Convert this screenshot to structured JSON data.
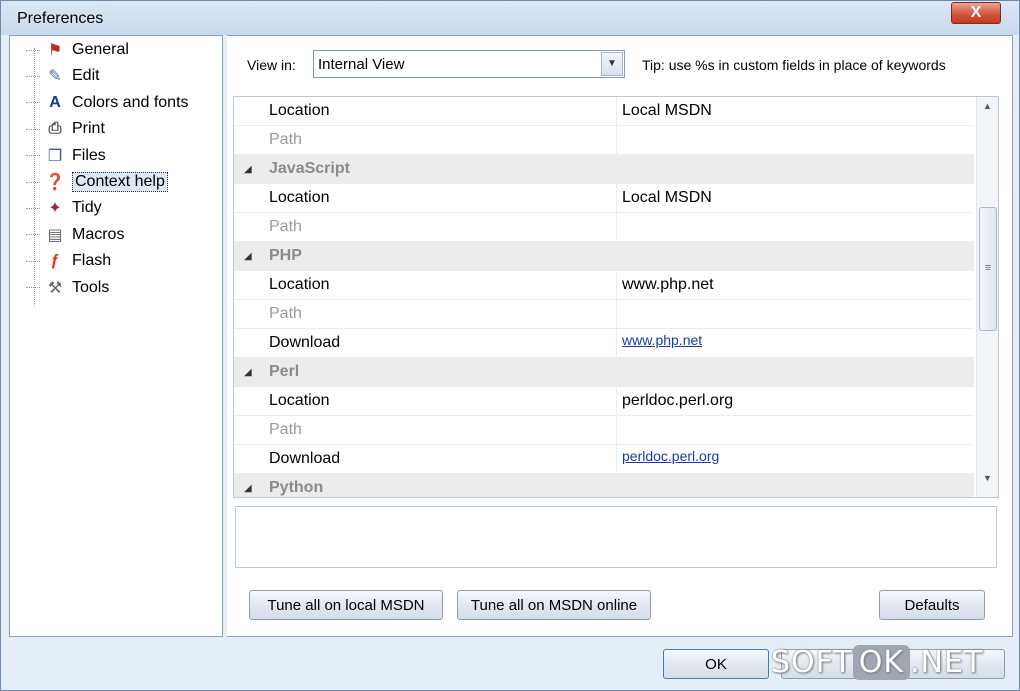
{
  "window": {
    "title": "Preferences",
    "close_label": "X"
  },
  "tree": [
    {
      "label": "General",
      "icon": "general-icon",
      "glyph": "⚑",
      "color": "#c0282a"
    },
    {
      "label": "Edit",
      "icon": "edit-icon",
      "glyph": "✎",
      "color": "#4a6aa0"
    },
    {
      "label": "Colors and fonts",
      "icon": "font-icon",
      "glyph": "A",
      "color": "#1a3a8a"
    },
    {
      "label": "Print",
      "icon": "printer-icon",
      "glyph": "⎙",
      "color": "#555555"
    },
    {
      "label": "Files",
      "icon": "files-icon",
      "glyph": "❐",
      "color": "#3a5aa0"
    },
    {
      "label": "Context help",
      "icon": "help-icon",
      "glyph": "❓",
      "color": "#3a70c0"
    },
    {
      "label": "Tidy",
      "icon": "tidy-icon",
      "glyph": "✦",
      "color": "#a02050"
    },
    {
      "label": "Macros",
      "icon": "macros-icon",
      "glyph": "▤",
      "color": "#666666"
    },
    {
      "label": "Flash",
      "icon": "flash-icon",
      "glyph": "ƒ",
      "color": "#e03010"
    },
    {
      "label": "Tools",
      "icon": "tools-icon",
      "glyph": "⚒",
      "color": "#666666"
    }
  ],
  "selected_tree_index": 5,
  "view_in": {
    "label": "View in:",
    "value": "Internal View"
  },
  "tip": "Tip: use %s in custom fields in place of keywords",
  "rows": [
    {
      "type": "prop",
      "key": "Location",
      "value": "Local MSDN"
    },
    {
      "type": "prop",
      "key": "Path",
      "value": "",
      "muted": true
    },
    {
      "type": "group",
      "key": "JavaScript"
    },
    {
      "type": "prop",
      "key": "Location",
      "value": "Local MSDN"
    },
    {
      "type": "prop",
      "key": "Path",
      "value": "",
      "muted": true
    },
    {
      "type": "group",
      "key": "PHP"
    },
    {
      "type": "prop",
      "key": "Location",
      "value": "www.php.net"
    },
    {
      "type": "prop",
      "key": "Path",
      "value": "",
      "muted": true
    },
    {
      "type": "prop",
      "key": "Download",
      "value": "www.php.net",
      "link": true
    },
    {
      "type": "group",
      "key": "Perl"
    },
    {
      "type": "prop",
      "key": "Location",
      "value": "perldoc.perl.org"
    },
    {
      "type": "prop",
      "key": "Path",
      "value": "",
      "muted": true
    },
    {
      "type": "prop",
      "key": "Download",
      "value": "perldoc.perl.org",
      "link": true
    },
    {
      "type": "group",
      "key": "Python"
    }
  ],
  "buttons": {
    "tune_local": "Tune all on local MSDN",
    "tune_online": "Tune all on MSDN online",
    "defaults": "Defaults",
    "ok": "OK"
  },
  "watermark": {
    "left": "SOFT",
    "middle": "OK",
    "right": ".NET"
  }
}
